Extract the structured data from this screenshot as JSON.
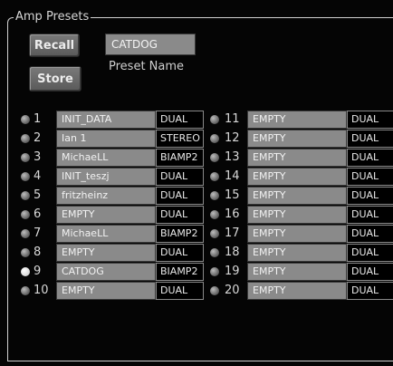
{
  "panel": {
    "title": "Amp Presets",
    "recall_label": "Recall",
    "store_label": "Store",
    "current_preset_name": "CATDOG",
    "preset_name_label": "Preset Name"
  },
  "presets": [
    {
      "num": "1",
      "name": "INIT_DATA",
      "mode": "DUAL",
      "active": false
    },
    {
      "num": "2",
      "name": "Ian 1",
      "mode": "STEREO",
      "active": false
    },
    {
      "num": "3",
      "name": "MichaeLL",
      "mode": "BIAMP2",
      "active": false
    },
    {
      "num": "4",
      "name": "INIT_teszj",
      "mode": "DUAL",
      "active": false
    },
    {
      "num": "5",
      "name": "fritzheinz",
      "mode": "DUAL",
      "active": false
    },
    {
      "num": "6",
      "name": "EMPTY",
      "mode": "DUAL",
      "active": false
    },
    {
      "num": "7",
      "name": "MichaeLL",
      "mode": "BIAMP2",
      "active": false
    },
    {
      "num": "8",
      "name": "EMPTY",
      "mode": "DUAL",
      "active": false
    },
    {
      "num": "9",
      "name": "CATDOG",
      "mode": "BIAMP2",
      "active": true
    },
    {
      "num": "10",
      "name": "EMPTY",
      "mode": "DUAL",
      "active": false
    },
    {
      "num": "11",
      "name": "EMPTY",
      "mode": "DUAL",
      "active": false
    },
    {
      "num": "12",
      "name": "EMPTY",
      "mode": "DUAL",
      "active": false
    },
    {
      "num": "13",
      "name": "EMPTY",
      "mode": "DUAL",
      "active": false
    },
    {
      "num": "14",
      "name": "EMPTY",
      "mode": "DUAL",
      "active": false
    },
    {
      "num": "15",
      "name": "EMPTY",
      "mode": "DUAL",
      "active": false
    },
    {
      "num": "16",
      "name": "EMPTY",
      "mode": "DUAL",
      "active": false
    },
    {
      "num": "17",
      "name": "EMPTY",
      "mode": "DUAL",
      "active": false
    },
    {
      "num": "18",
      "name": "EMPTY",
      "mode": "DUAL",
      "active": false
    },
    {
      "num": "19",
      "name": "EMPTY",
      "mode": "DUAL",
      "active": false
    },
    {
      "num": "20",
      "name": "EMPTY",
      "mode": "DUAL",
      "active": false
    }
  ]
}
